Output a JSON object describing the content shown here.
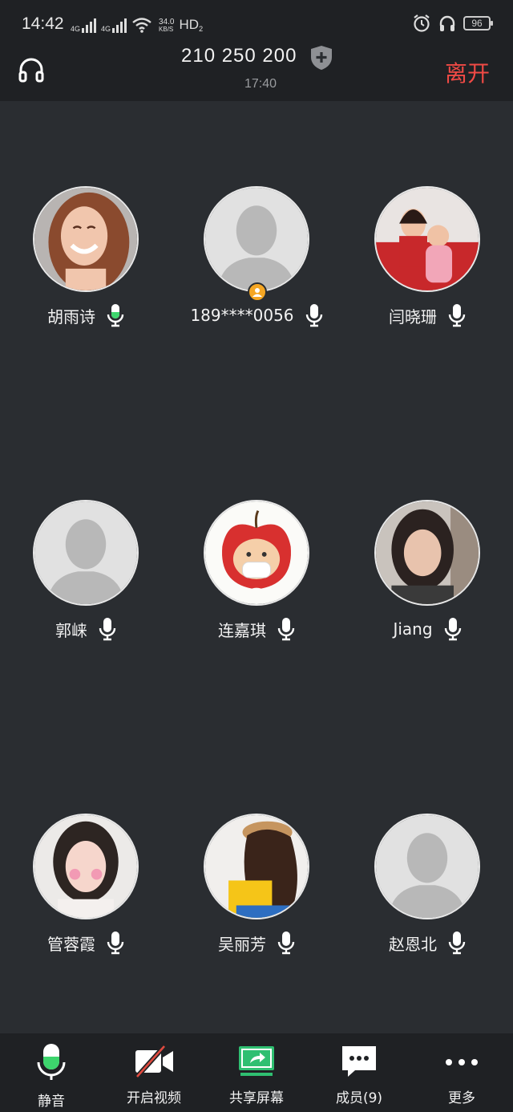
{
  "statusbar": {
    "time": "14:42",
    "net1": "4G",
    "net2": "4G",
    "speed_value": "34.0",
    "speed_unit": "KB/S",
    "hd": "HD",
    "hd_sub": "2",
    "battery": "96"
  },
  "header": {
    "meeting_id": "210 250 200",
    "meeting_time": "17:40",
    "leave_label": "离开"
  },
  "participants": [
    {
      "name": "胡雨诗",
      "prefix": "",
      "mic_active": true,
      "avatar": "photo-woman-smiling"
    },
    {
      "name": "189****0056",
      "mic_active": false,
      "avatar": "default",
      "host": true
    },
    {
      "name": "闫晓珊",
      "mic_active": false,
      "avatar": "photo-baby-red"
    },
    {
      "name": "郭崃",
      "mic_active": false,
      "avatar": "default"
    },
    {
      "name": "连嘉琪",
      "mic_active": false,
      "avatar": "cartoon-apple"
    },
    {
      "name": "Jiang",
      "mic_active": false,
      "avatar": "photo-woman-dark-hair"
    },
    {
      "name": "管蓉霞",
      "mic_active": false,
      "avatar": "photo-woman-pink"
    },
    {
      "name": "吴丽芳",
      "suffix": "",
      "mic_active": false,
      "avatar": "photo-woman-yellow"
    },
    {
      "name": "赵恩北",
      "mic_active": false,
      "avatar": "default"
    }
  ],
  "toolbar": {
    "mute_label": "静音",
    "video_label": "开启视频",
    "share_label": "共享屏幕",
    "members_label": "成员(9)",
    "more_label": "更多"
  },
  "colors": {
    "background": "#2a2d31",
    "bar": "#1f2124",
    "accent_green": "#3dd56d",
    "leave_red": "#f04a45",
    "host_badge": "#f5a623"
  }
}
